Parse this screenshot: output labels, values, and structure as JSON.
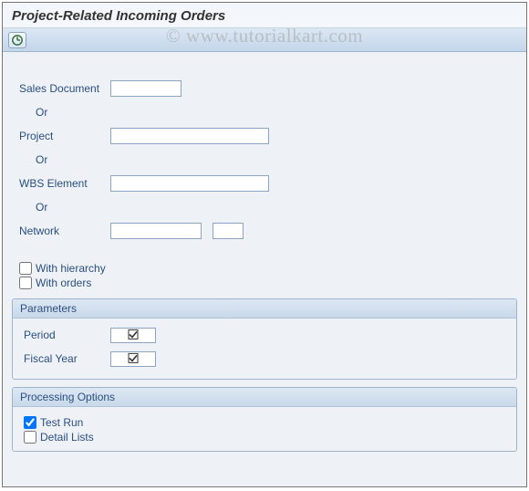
{
  "title": "Project-Related Incoming Orders",
  "watermark": "© www.tutorialkart.com",
  "toolbar": {
    "execute_tooltip": "Execute"
  },
  "selection": {
    "sales_doc_label": "Sales Document",
    "sales_doc_value": "",
    "or_label": "Or",
    "project_label": "Project",
    "project_value": "",
    "wbs_label": "WBS Element",
    "wbs_value": "",
    "network_label": "Network",
    "network_value1": "",
    "network_value2": ""
  },
  "options": {
    "with_hierarchy_label": "With hierarchy",
    "with_hierarchy_checked": false,
    "with_orders_label": "With orders",
    "with_orders_checked": false
  },
  "parameters": {
    "group_title": "Parameters",
    "period_label": "Period",
    "period_value": "",
    "period_required": true,
    "fiscal_year_label": "Fiscal Year",
    "fiscal_year_value": "",
    "fiscal_year_required": true
  },
  "processing": {
    "group_title": "Processing Options",
    "test_run_label": "Test Run",
    "test_run_checked": true,
    "detail_lists_label": "Detail Lists",
    "detail_lists_checked": false
  }
}
